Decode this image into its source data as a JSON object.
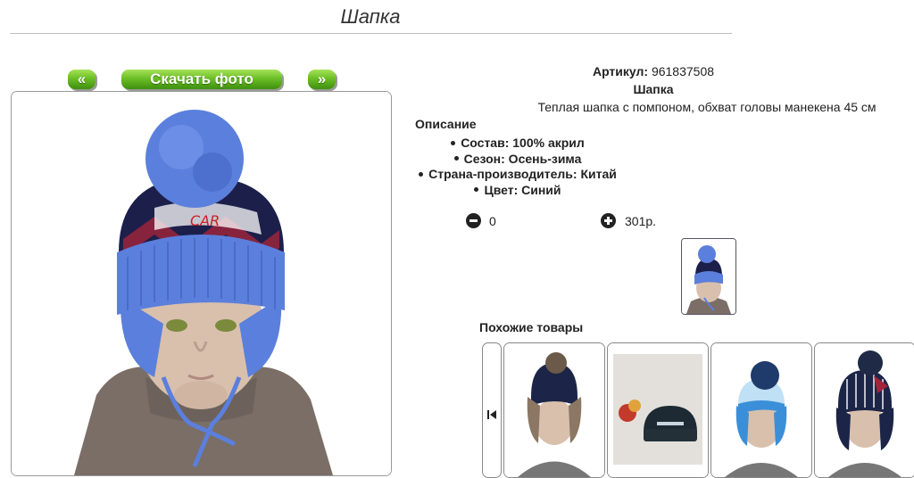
{
  "page": {
    "title": "Шапка"
  },
  "gallery": {
    "prev_label": "«",
    "download_label": "Скачать фото",
    "next_label": "»"
  },
  "product": {
    "sku_label": "Артикул:",
    "sku_value": "961837508",
    "name": "Шапка",
    "description": "Теплая шапка с помпоном, обхват головы манекена 45 см",
    "description_heading": "Описание",
    "specs": [
      "Состав: 100% акрил",
      "Сезон: Осень-зима",
      "Страна-производитель: Китай",
      "Цвет: Синий"
    ],
    "quantity": "0",
    "price": "301р."
  },
  "similar": {
    "heading": "Похожие товары"
  },
  "colors": {
    "button_green": "#6cbf26",
    "hat_blue": "#5b7fdc",
    "hat_navy": "#1c1f4a",
    "hat_red": "#a2243a",
    "sweater_brown": "#7a6e66"
  }
}
